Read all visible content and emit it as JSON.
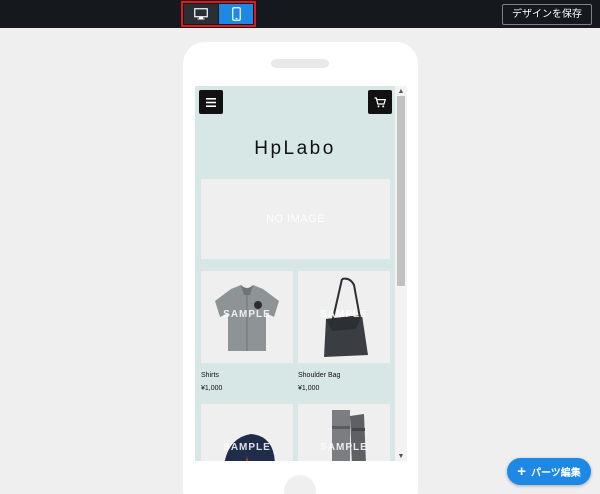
{
  "toolbar": {
    "save_label": "デザインを保存",
    "devices": [
      {
        "name": "desktop",
        "icon": "desktop-icon",
        "active": false
      },
      {
        "name": "mobile",
        "icon": "mobile-icon",
        "active": true
      }
    ]
  },
  "site": {
    "logo": "HpLabo",
    "hero_placeholder": "NO IMAGE",
    "products": [
      {
        "name": "Shirts",
        "price": "¥1,000",
        "watermark": "SAMPLE"
      },
      {
        "name": "Shoulder Bag",
        "price": "¥1,000",
        "watermark": "SAMPLE"
      },
      {
        "name": "",
        "price": "",
        "watermark": "SAMPLE"
      },
      {
        "name": "",
        "price": "",
        "watermark": "SAMPLE"
      }
    ]
  },
  "fab": {
    "label": "パーツ編集",
    "icon": "plus-icon"
  },
  "colors": {
    "topbar": "#15191e",
    "accent": "#1e88e5",
    "highlight": "#e5161d",
    "site_bg": "#d6e7e5"
  }
}
